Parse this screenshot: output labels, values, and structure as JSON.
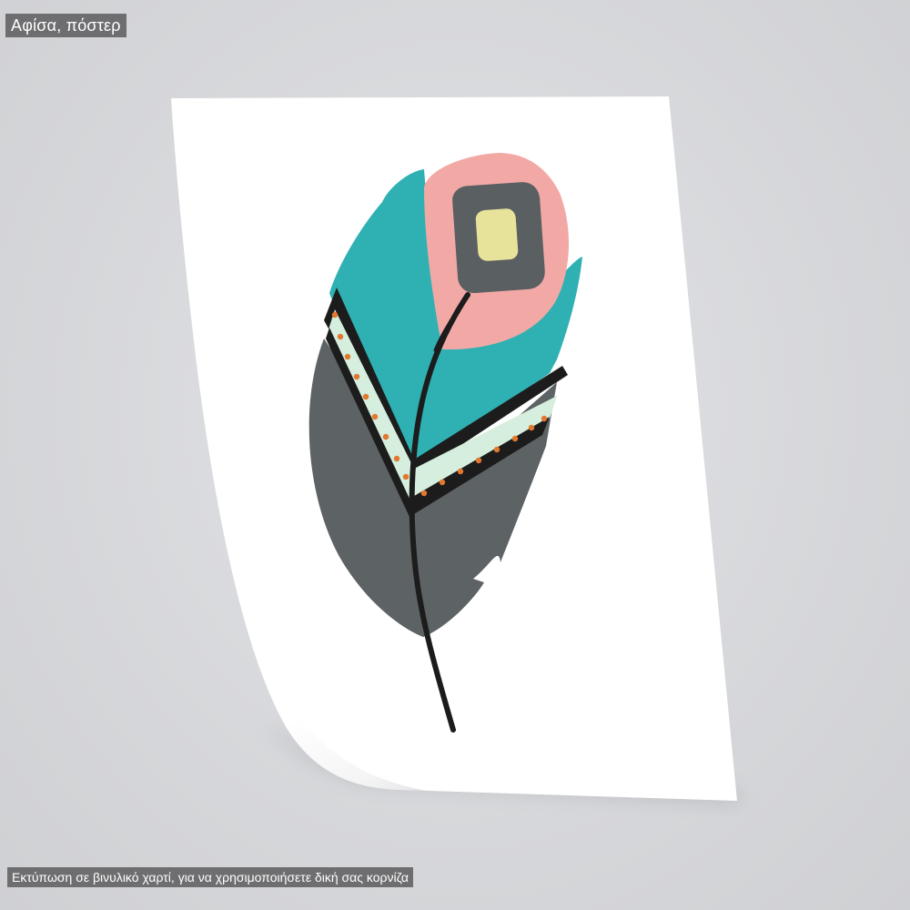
{
  "header": {
    "label": "Αφίσα, πόστερ"
  },
  "footer": {
    "caption": "Εκτύπωση σε βινυλικό χαρτί, για να χρησιμοποιήσετε δική σας κορνίζα"
  },
  "artwork": {
    "subject": "feather-illustration",
    "colors": {
      "background": "#d8d9dc",
      "paper": "#ffffff",
      "teal": "#2fb0b2",
      "pink": "#f2a9a6",
      "grey": "#5d6265",
      "dark_grey": "#5a5f62",
      "yellow": "#e8e39a",
      "mint": "#d5eedd",
      "dots": "#e2782e",
      "stroke": "#1c1c1c",
      "label_bg": "#6e6e70"
    }
  }
}
